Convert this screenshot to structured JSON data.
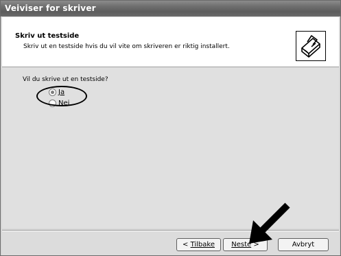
{
  "window": {
    "title": "Veiviser for skriver"
  },
  "header": {
    "title": "Skriv ut testside",
    "subtitle": "Skriv ut en testside hvis du vil vite om skriveren er riktig installert.",
    "icon": "printer-icon"
  },
  "body": {
    "question": "Vil du skrive ut en testside?",
    "options": [
      {
        "label": "Ja",
        "selected": true
      },
      {
        "label": "Nei",
        "selected": false
      }
    ]
  },
  "buttons": {
    "back_arrow": "< ",
    "back_label": "Tilbake",
    "next_label": "Neste",
    "next_arrow": " >",
    "cancel_label": "Avbryt"
  },
  "colors": {
    "title_bar": "#6f6f6f",
    "dialog_bg": "#e0e0e0",
    "header_bg": "#ffffff"
  }
}
